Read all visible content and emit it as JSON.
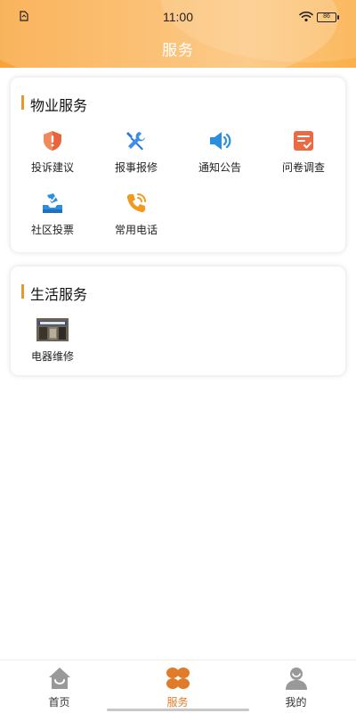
{
  "status_bar": {
    "time": "11:00",
    "battery": "86"
  },
  "header": {
    "title": "服务"
  },
  "property_services": {
    "title": "物业服务",
    "items": [
      {
        "label": "投诉建议",
        "icon": "shield-alert-icon",
        "color": "#e8643c"
      },
      {
        "label": "报事报修",
        "icon": "tools-icon",
        "color": "#2b7bd8"
      },
      {
        "label": "通知公告",
        "icon": "megaphone-icon",
        "color": "#2b8fe0"
      },
      {
        "label": "问卷调查",
        "icon": "survey-icon",
        "color": "#ea6a45"
      },
      {
        "label": "社区投票",
        "icon": "vote-box-icon",
        "color": "#2b8fe0"
      },
      {
        "label": "常用电话",
        "icon": "phone-icon",
        "color": "#f29a1e"
      }
    ]
  },
  "life_services": {
    "title": "生活服务",
    "items": [
      {
        "label": "电器维修",
        "icon": "shop-photo-icon"
      }
    ]
  },
  "bottom_nav": {
    "items": [
      {
        "label": "首页",
        "icon": "home-icon"
      },
      {
        "label": "服务",
        "icon": "services-icon",
        "active": true
      },
      {
        "label": "我的",
        "icon": "profile-icon"
      }
    ]
  },
  "colors": {
    "accent": "#e6972e",
    "active_tab": "#e07b2a",
    "header_orange": "#f8a33a"
  }
}
